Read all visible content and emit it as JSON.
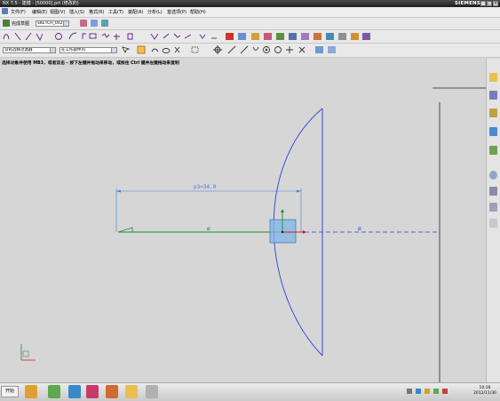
{
  "window": {
    "title": "NX 7.5 - 建模 - [50000].prt (修改的)",
    "brand": "SIEMENS"
  },
  "menu": [
    "文件(F)",
    "编辑(E)",
    "视图(V)",
    "插入(S)",
    "格式(R)",
    "工具(T)",
    "装配(A)",
    "分析(L)",
    "首选项(P)",
    "帮助(H)"
  ],
  "sketch": {
    "finish_label": "完成草图",
    "sketch_name": "SKETCH_002"
  },
  "filter": {
    "selection_filter": "没有选择过滤器",
    "scope": "在工作部件内"
  },
  "status": {
    "message": "选择对象并使用 MB3，或者双击 - 按下左键并拖动来移动，或按住 Ctrl 键并左键拖动来复制"
  },
  "dimension": {
    "label": "p3=34.0"
  },
  "constraint_symbol": "ø",
  "taskbar": {
    "start": "开始",
    "time": "10:36",
    "date": "2012/11/30"
  },
  "colors": {
    "title_bg": "#2a2a2a",
    "canvas": "#d6d6d6",
    "arc": "#2b3fd6",
    "axis": "#1f8a3a",
    "dim": "#4a7bd8",
    "dash": "#2b3fd6"
  }
}
